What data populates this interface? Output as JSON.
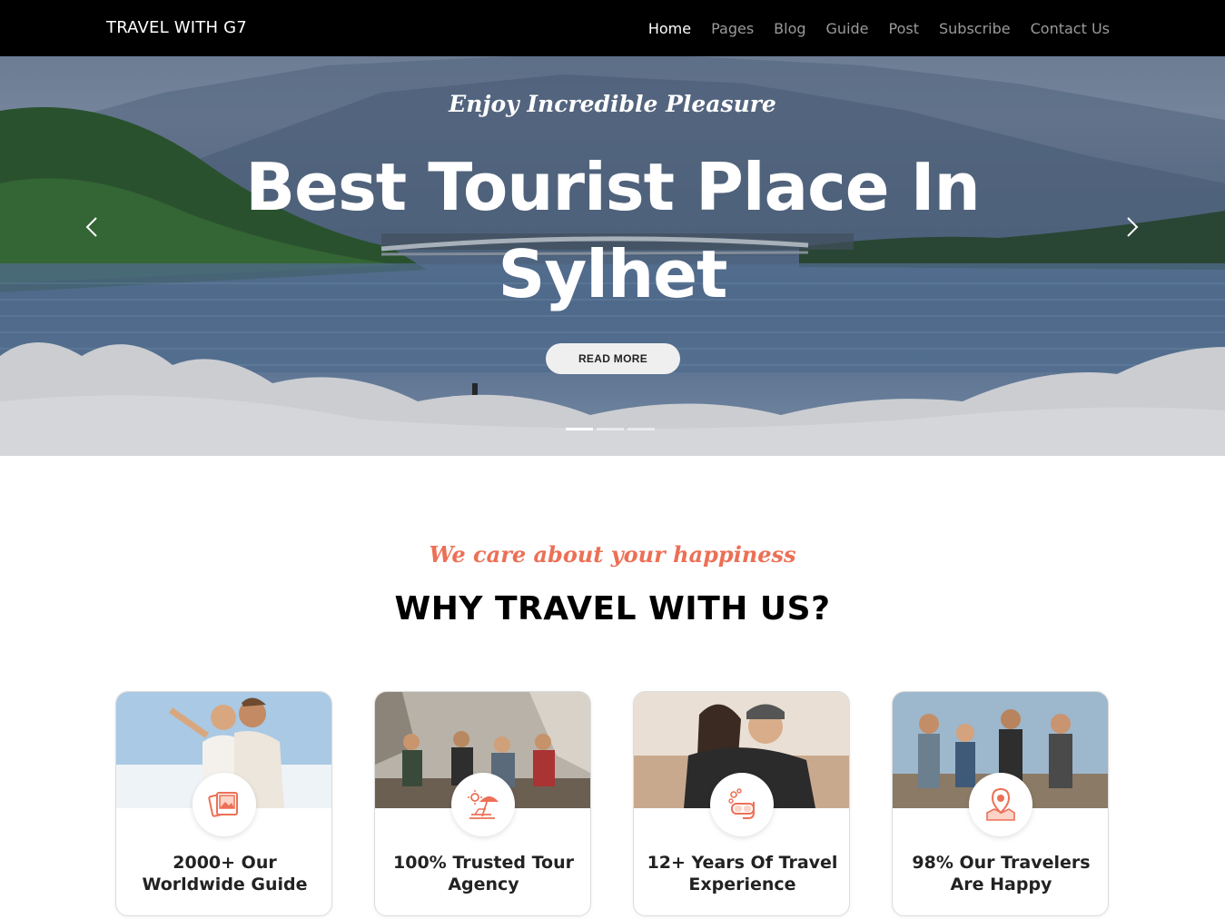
{
  "nav": {
    "brand": "TRAVEL WITH G7",
    "links": [
      "Home",
      "Pages",
      "Blog",
      "Guide",
      "Post",
      "Subscribe",
      "Contact Us"
    ],
    "active": "Home"
  },
  "hero": {
    "subtitle": "Enjoy Incredible Pleasure",
    "title_line1": "Best Tourist Place In",
    "title_line2": "Sylhet",
    "button": "READ MORE",
    "slides": 3,
    "active_slide": 1
  },
  "section": {
    "tagline": "We care about your happiness",
    "title": "WHY TRAVEL WITH US?"
  },
  "features": [
    {
      "line1": "2000+ Our",
      "line2": "Worldwide Guide",
      "icon": "photo-gallery-icon"
    },
    {
      "line1": "100% Trusted Tour",
      "line2": "Agency",
      "icon": "beach-umbrella-icon"
    },
    {
      "line1": "12+ Years Of Travel",
      "line2": "Experience",
      "icon": "diving-mask-icon"
    },
    {
      "line1": "98% Our Travelers",
      "line2": "Are Happy",
      "icon": "map-pin-icon"
    }
  ],
  "colors": {
    "accent": "#ec7056",
    "nav_bg": "#000000",
    "nav_link": "#9a9a9a"
  }
}
